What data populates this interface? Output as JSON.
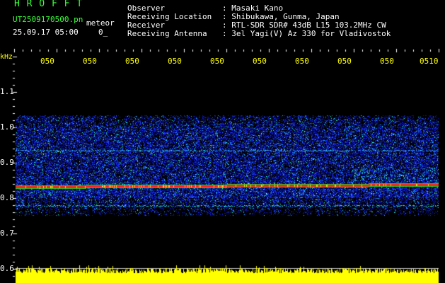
{
  "header": {
    "logo": "H R O F F T",
    "filename": "UT2509170500.pn",
    "meteor_label": "meteor",
    "datetime": "25.09.17 05:00",
    "count": "0_",
    "info_labels": [
      "Observer",
      "Receiving Location",
      "Receiver",
      "Receiving Antenna"
    ],
    "info_values": [
      ": Masaki Kano",
      ": Shibukawa, Gunma, Japan",
      ": RTL-SDR SDR# 43dB L15 103.2MHz CW",
      ": 3el Yagi(V) Az 330 for Vladivostok"
    ]
  },
  "axis": {
    "unit": "kHz",
    "y_ticks": [
      "1.1",
      "1.0",
      "0.9",
      "0.8",
      "0.7",
      "0.6"
    ],
    "time_ticks": [
      "050",
      "050",
      "050",
      "050",
      "050",
      "050",
      "050",
      "050",
      "050",
      "0510"
    ]
  },
  "colors": {
    "header_green": "#3aff3a",
    "tick_yellow": "#ffff00",
    "background": "#000000",
    "echo_red": "#ff2020",
    "noise_blue": "#1a2cff"
  }
}
